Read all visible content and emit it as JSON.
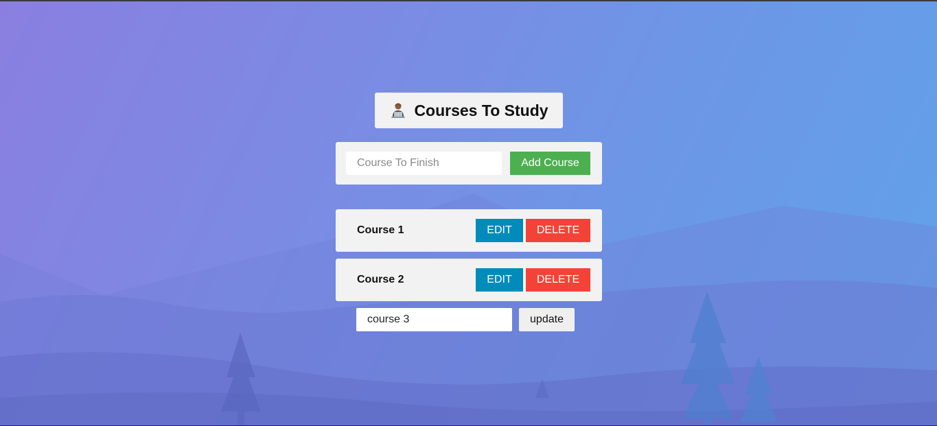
{
  "header": {
    "icon": "person-at-laptop-icon",
    "title": "Courses To Study"
  },
  "add_form": {
    "placeholder": "Course To Finish",
    "value": "",
    "button_label": "Add Course",
    "button_color": "#4caf50"
  },
  "courses": [
    {
      "name": "Course 1",
      "edit_label": "EDIT",
      "delete_label": "DELETE"
    },
    {
      "name": "Course 2",
      "edit_label": "EDIT",
      "delete_label": "DELETE"
    }
  ],
  "edit_form": {
    "value": "course 3",
    "button_label": "update"
  },
  "colors": {
    "edit": "#008cba",
    "delete": "#f44336",
    "card": "#f2f2f2"
  }
}
